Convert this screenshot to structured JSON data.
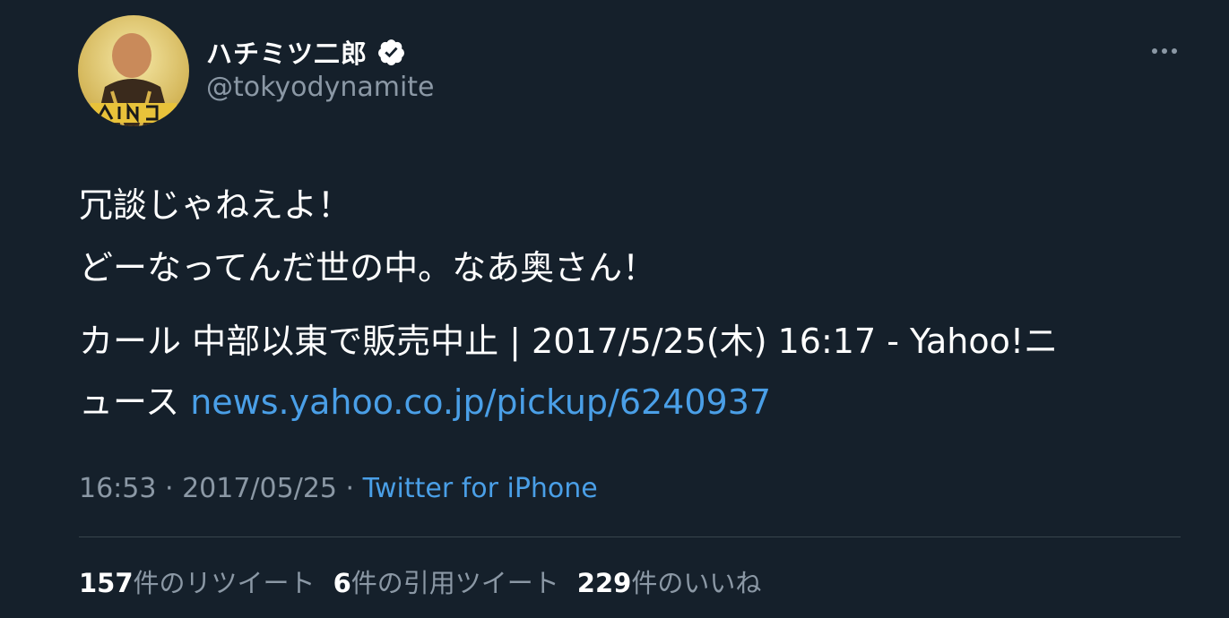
{
  "user": {
    "display_name": "ハチミツ二郎",
    "handle": "@tokyodynamite",
    "avatar_icon": "avatar-image",
    "verified_icon": "verified-badge-icon"
  },
  "tweet": {
    "line1": "冗談じゃねえよ！",
    "line2": "どーなってんだ世の中。なあ奥さん！",
    "line3": "カール 中部以東で販売中止 | 2017/5/25(木) 16:17 - Yahoo!ニ",
    "line4_prefix": "ュース ",
    "link": "news.yahoo.co.jp/pickup/6240937"
  },
  "meta": {
    "time": "16:53",
    "separator": " · ",
    "date": "2017/05/25",
    "source": "Twitter for iPhone"
  },
  "stats": {
    "retweets_count": "157",
    "retweets_label": "件のリツイート",
    "quotes_count": "6",
    "quotes_label": "件の引用ツイート",
    "likes_count": "229",
    "likes_label": "件のいいね"
  },
  "colors": {
    "background": "#15202b",
    "link": "#4a9fe7",
    "secondary_text": "#8b98a5"
  }
}
